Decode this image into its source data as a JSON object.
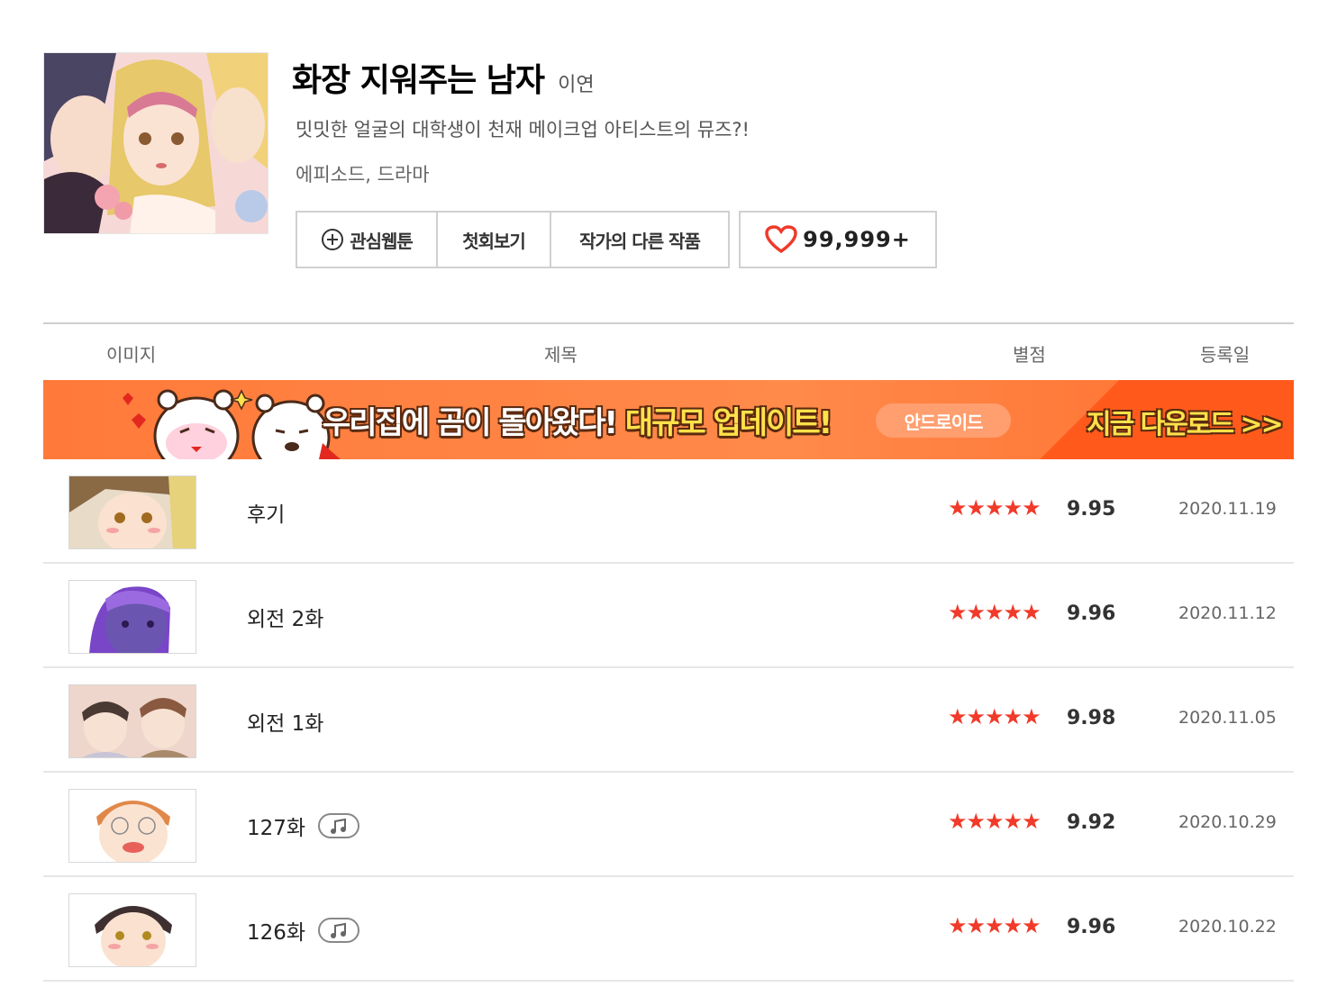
{
  "comic": {
    "title": "화장 지워주는 남자",
    "author": "이연",
    "synopsis": "밋밋한 얼굴의 대학생이 천재 메이크업 아티스트의 뮤즈?!",
    "genre": "에피소드, 드라마",
    "buttons": {
      "favorite": "관심웹툰",
      "first_episode": "첫회보기",
      "other_works": "작가의 다른 작품"
    },
    "likes": "99,999+"
  },
  "table": {
    "headers": {
      "image": "이미지",
      "title": "제목",
      "rating": "별점",
      "date": "등록일"
    }
  },
  "banner": {
    "text_main": "우리집에 곰이 돌아왔다!",
    "text_highlight": "대규모 업데이트!",
    "platform": "안드로이드",
    "cta": "지금 다운로드 >>"
  },
  "episodes": [
    {
      "title": "후기",
      "stars": "★★★★★",
      "score": "9.95",
      "date": "2020.11.19",
      "bgm": false
    },
    {
      "title": "외전 2화",
      "stars": "★★★★★",
      "score": "9.96",
      "date": "2020.11.12",
      "bgm": false
    },
    {
      "title": "외전 1화",
      "stars": "★★★★★",
      "score": "9.98",
      "date": "2020.11.05",
      "bgm": false
    },
    {
      "title": "127화",
      "stars": "★★★★★",
      "score": "9.92",
      "date": "2020.10.29",
      "bgm": true
    },
    {
      "title": "126화",
      "stars": "★★★★★",
      "score": "9.96",
      "date": "2020.10.22",
      "bgm": true
    }
  ],
  "colors": {
    "star": "#f03a2a",
    "heart": "#f03a2a",
    "banner_bg": "#ff7a3a",
    "banner_highlight": "#ffe14a"
  },
  "icons": {
    "favorite": "plus-circle-icon",
    "likes": "heart-icon",
    "bgm": "music-note-icon"
  }
}
